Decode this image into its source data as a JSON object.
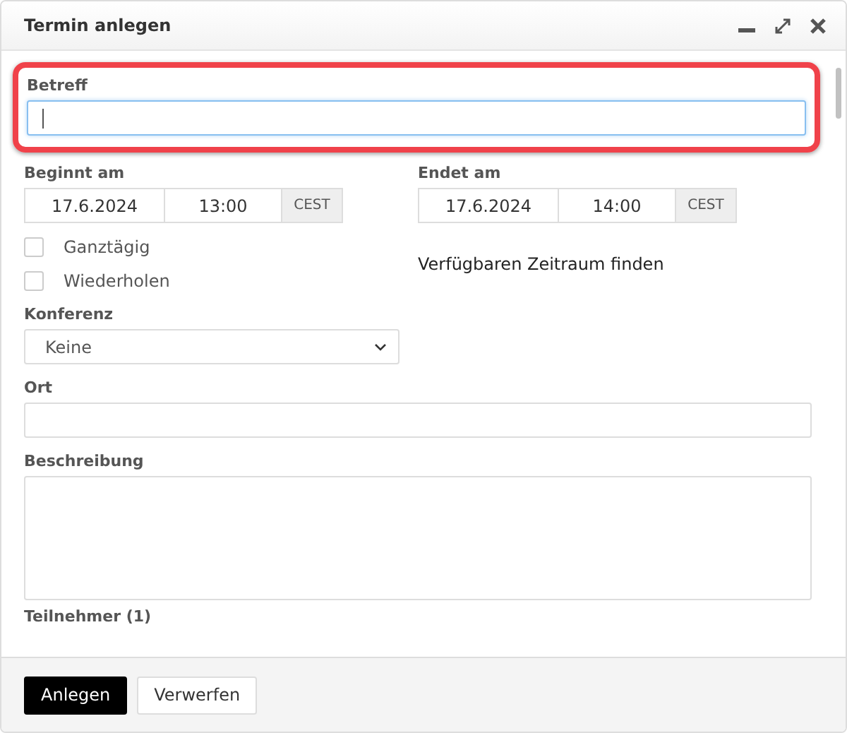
{
  "window": {
    "title": "Termin anlegen"
  },
  "subject": {
    "label": "Betreff",
    "focused": true
  },
  "start": {
    "label": "Beginnt am",
    "date": "17.6.2024",
    "time": "13:00",
    "timezone": "CEST"
  },
  "end": {
    "label": "Endet am",
    "date": "17.6.2024",
    "time": "14:00",
    "timezone": "CEST"
  },
  "options": [
    {
      "label": "Ganztägig",
      "checked": false
    },
    {
      "label": "Wiederholen",
      "checked": false
    }
  ],
  "find_slot_link": "Verfügbaren Zeitraum finden",
  "conference": {
    "label": "Konferenz",
    "value": "Keine"
  },
  "location": {
    "label": "Ort"
  },
  "description": {
    "label": "Beschreibung"
  },
  "participants_heading": "Teilnehmer (1)",
  "buttons": [
    {
      "label": "Anlegen",
      "kind": "primary"
    },
    {
      "label": "Verwerfen",
      "kind": "secondary"
    }
  ]
}
